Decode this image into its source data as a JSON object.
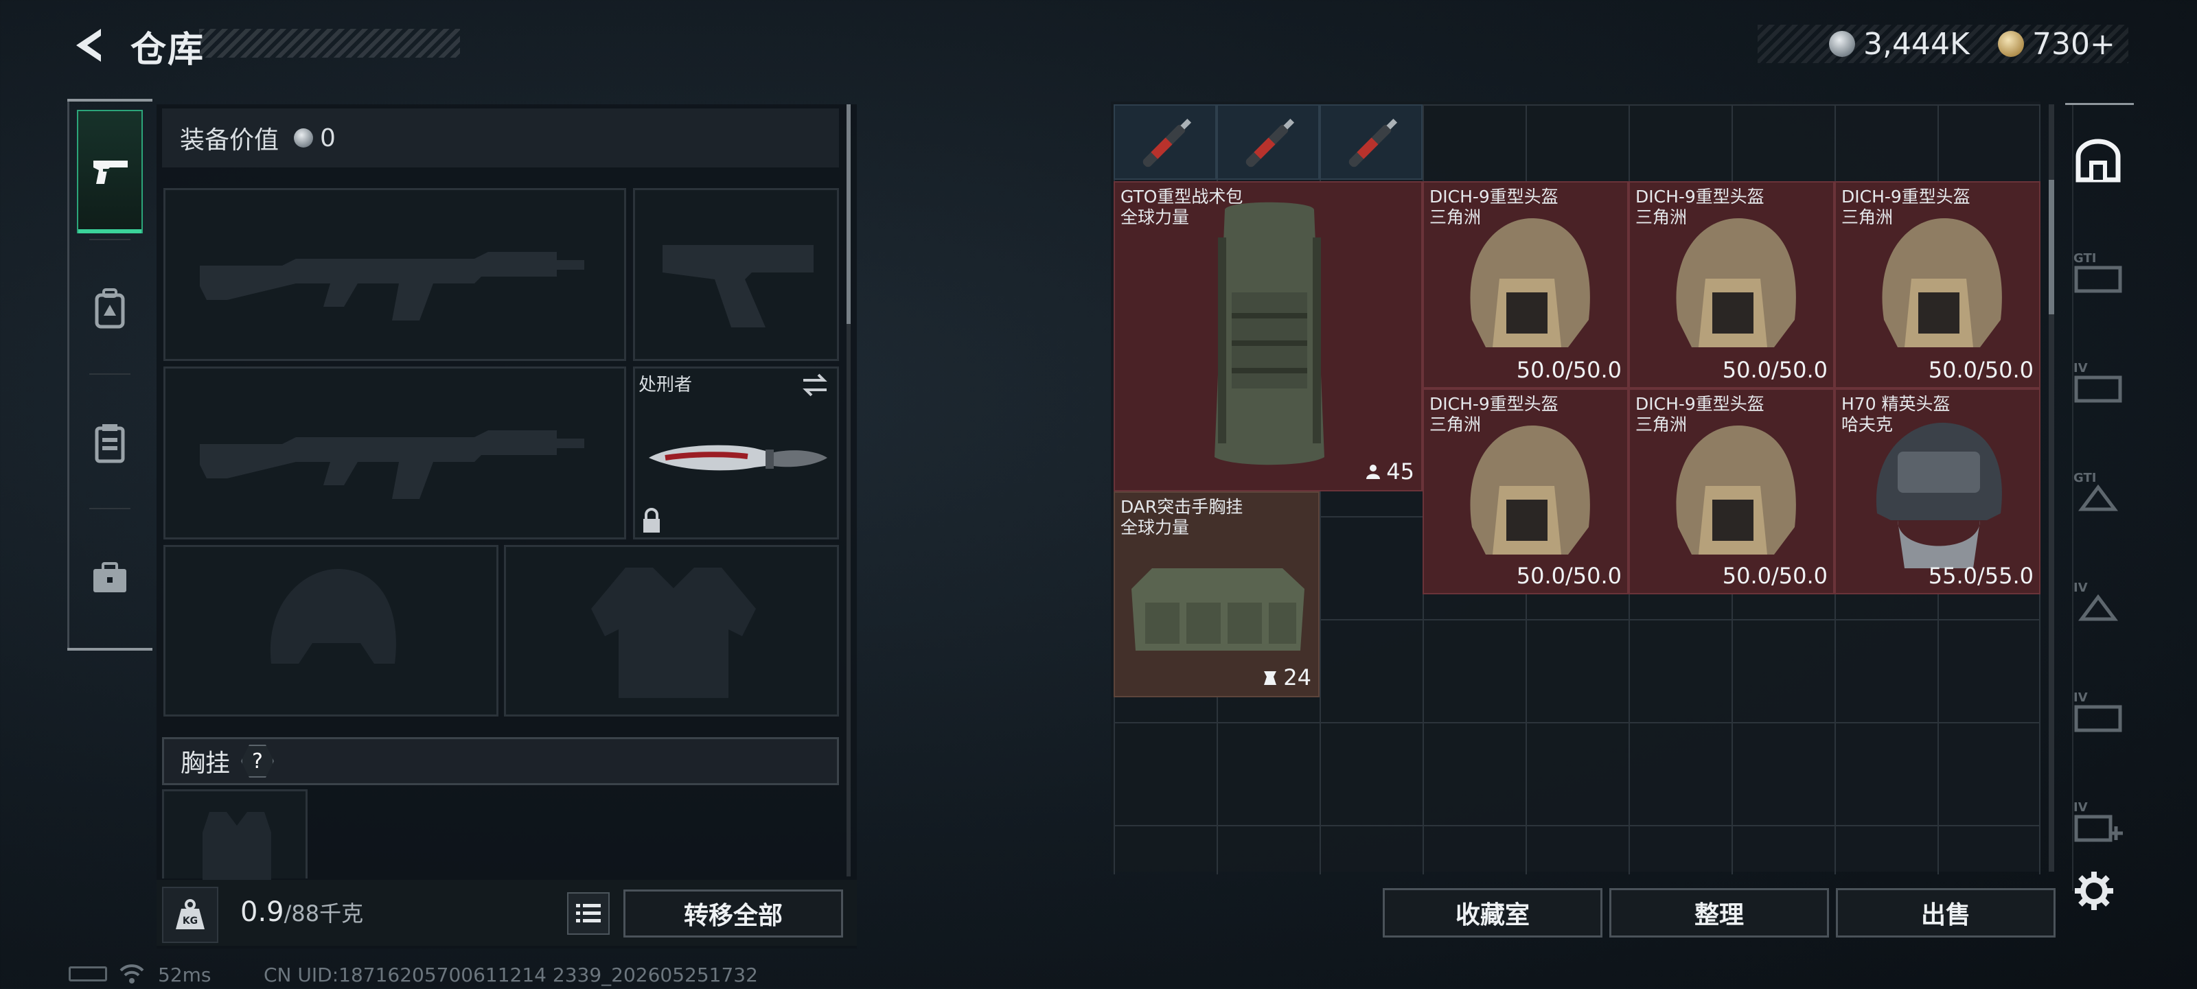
{
  "header": {
    "title": "仓库"
  },
  "currency": {
    "silver": "3,444K",
    "gold": "730+"
  },
  "loadout": {
    "equip_value_label": "装备价值",
    "equip_value": "0",
    "melee_name": "处刑者",
    "chest_label": "胸挂",
    "chest_help": "?"
  },
  "weight": {
    "current": "0.9",
    "max": "/88千克"
  },
  "buttons": {
    "transfer_all": "转移全部",
    "collection": "收藏室",
    "organize": "整理",
    "sell": "出售"
  },
  "status": {
    "ping": "52ms",
    "uid": "CN UID:18716205700611214 2339_202605251732"
  },
  "storage_items": [
    {
      "name": "GTO重型战术包",
      "sub": "全球力量",
      "count": "45"
    },
    {
      "name": "DICH-9重型头盔",
      "sub": "三角洲",
      "value": "50.0/50.0"
    },
    {
      "name": "DICH-9重型头盔",
      "sub": "三角洲",
      "value": "50.0/50.0"
    },
    {
      "name": "DICH-9重型头盔",
      "sub": "三角洲",
      "value": "50.0/50.0"
    },
    {
      "name": "DICH-9重型头盔",
      "sub": "三角洲",
      "value": "50.0/50.0"
    },
    {
      "name": "DICH-9重型头盔",
      "sub": "三角洲",
      "value": "50.0/50.0"
    },
    {
      "name": "H70 精英头盔",
      "sub": "哈夫克",
      "value": "55.0/55.0"
    },
    {
      "name": "DAR突击手胸挂",
      "sub": "全球力量",
      "count": "24"
    }
  ],
  "right_tabs": [
    "GTI",
    "IV",
    "GTI",
    "IV",
    "IV",
    "IV"
  ]
}
